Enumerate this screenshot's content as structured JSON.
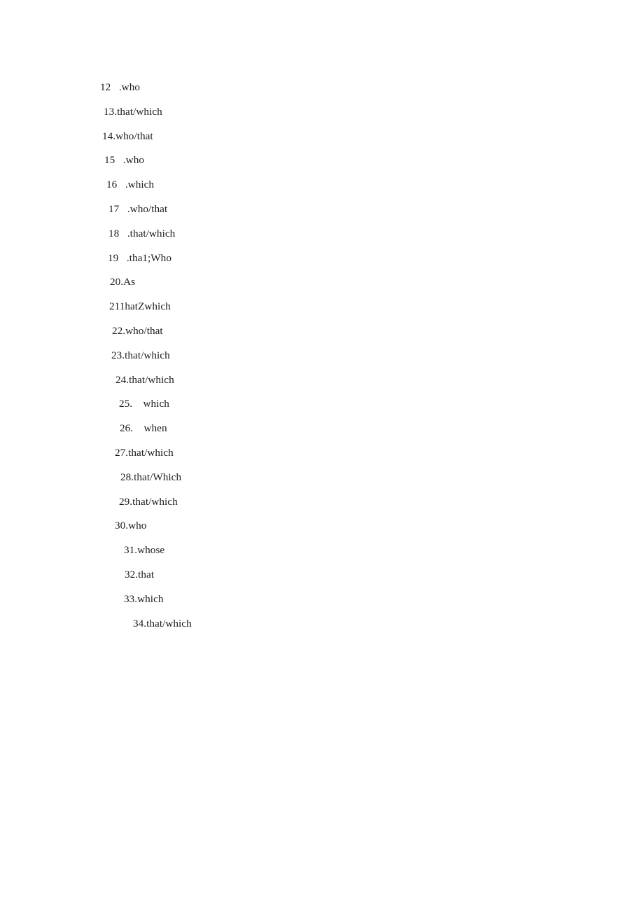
{
  "document": {
    "type": "answer-key",
    "background_color": "#ffffff",
    "text_color": "#1b1b1b",
    "answers": [
      {
        "text": "12   .who",
        "indent": 143
      },
      {
        "text": "13.that/which",
        "indent": 148
      },
      {
        "text": "14.who/that",
        "indent": 146
      },
      {
        "text": "15   .who",
        "indent": 149
      },
      {
        "text": "16   .which",
        "indent": 152
      },
      {
        "text": "17   .who/that",
        "indent": 155
      },
      {
        "text": "18   .that/which",
        "indent": 155
      },
      {
        "text": "19   .tha1;Who",
        "indent": 154
      },
      {
        "text": "20.As",
        "indent": 157
      },
      {
        "text": "211hatZwhich",
        "indent": 156
      },
      {
        "text": "22.who/that",
        "indent": 160
      },
      {
        "text": "23.that/which",
        "indent": 159
      },
      {
        "text": "24.that/which",
        "indent": 165
      },
      {
        "text": "25.    which",
        "indent": 170
      },
      {
        "text": "26.    when",
        "indent": 171
      },
      {
        "text": "27.that/which",
        "indent": 164
      },
      {
        "text": "28.that/Which",
        "indent": 172
      },
      {
        "text": "29.that/which",
        "indent": 170
      },
      {
        "text": "30.who",
        "indent": 164
      },
      {
        "text": "31.whose",
        "indent": 177
      },
      {
        "text": "32.that",
        "indent": 178
      },
      {
        "text": "33.which",
        "indent": 177
      },
      {
        "text": "34.that/which",
        "indent": 190
      }
    ]
  }
}
